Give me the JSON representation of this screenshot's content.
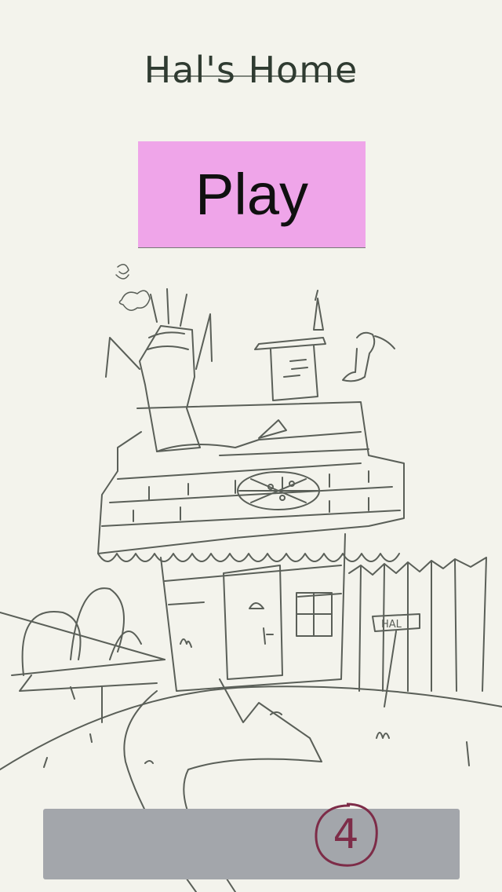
{
  "title": "Hal's Home",
  "play_button": {
    "label": "Play"
  },
  "level_badge": {
    "value": "4"
  },
  "scene": {
    "icon": "house-sketch-illustration",
    "sign_text": "HAL"
  },
  "colors": {
    "background": "#f3f3ec",
    "play_button": "#efa5e9",
    "bottom_bar": "#a3a6ab",
    "badge": "#7d2c48",
    "sketch": "#5a5f58"
  }
}
